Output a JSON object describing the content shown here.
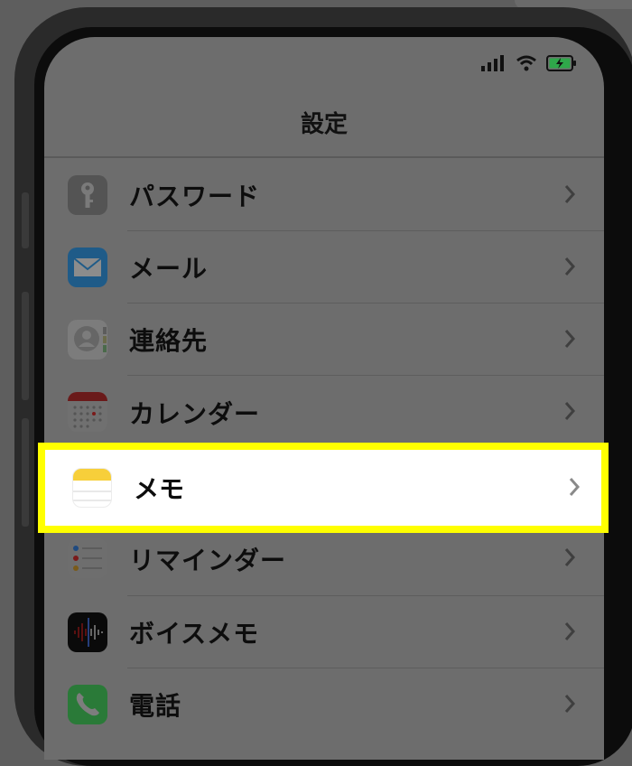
{
  "header": {
    "title": "設定"
  },
  "status_bar": {
    "signal_icon": "cellular-signal-icon",
    "wifi_icon": "wifi-icon",
    "battery_icon": "battery-charging-icon"
  },
  "settings_list": {
    "items": [
      {
        "label": "パスワード",
        "icon": "key-icon"
      },
      {
        "label": "メール",
        "icon": "mail-icon"
      },
      {
        "label": "連絡先",
        "icon": "contacts-icon"
      },
      {
        "label": "カレンダー",
        "icon": "calendar-icon"
      },
      {
        "label": "メモ",
        "icon": "notes-icon",
        "highlighted": true
      },
      {
        "label": "リマインダー",
        "icon": "reminders-icon"
      },
      {
        "label": "ボイスメモ",
        "icon": "voice-memos-icon"
      },
      {
        "label": "電話",
        "icon": "phone-icon"
      }
    ]
  },
  "colors": {
    "highlight_border": "#ffff00",
    "dim_overlay": "#6d6d6d"
  }
}
